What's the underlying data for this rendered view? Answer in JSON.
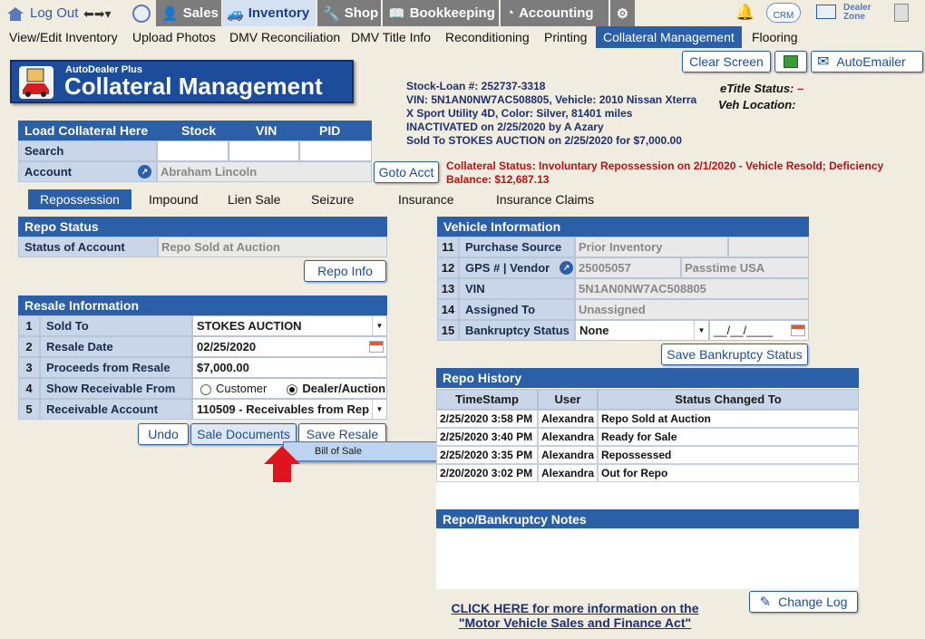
{
  "topnav": {
    "logout": "Log Out",
    "sales": "Sales",
    "inventory": "Inventory",
    "shop": "Shop",
    "bookkeeping": "Bookkeeping",
    "accounting": "Accounting",
    "crm": "CRM",
    "dealer_zone_1": "Dealer",
    "dealer_zone_2": "Zone"
  },
  "submenu": [
    "View/Edit Inventory",
    "Upload Photos",
    "DMV Reconciliation",
    "DMV Title Info",
    "Reconditioning",
    "Printing",
    "Collateral Management",
    "Flooring"
  ],
  "banner": {
    "small": "AutoDealer Plus",
    "title": "Collateral Management"
  },
  "toolbar": {
    "clear": "Clear Screen",
    "autoemail": "AutoEmailer"
  },
  "vehicle_summary": {
    "line1": "Stock-Loan #:  252737-3318",
    "line2": "VIN:  5N1AN0NW7AC508805, Vehicle:  2010 Nissan Xterra",
    "line3": "X Sport Utility 4D, Color: Silver, 81401 miles",
    "line4": "INACTIVATED on 2/25/2020 by A Azary",
    "line5": "Sold To STOKES AUCTION on 2/25/2020 for $7,000.00"
  },
  "etitle": {
    "label": "eTitle Status:",
    "value": "–",
    "veh_location": "Veh Location:"
  },
  "load": {
    "header": "Load Collateral Here",
    "stock": "Stock",
    "vin": "VIN",
    "pid": "PID",
    "search": "Search",
    "account": "Account",
    "account_value": "Abraham Lincoln",
    "goto": "Goto Acct"
  },
  "collateral_status": {
    "line1": "Collateral Status: Involuntary Repossession on 2/1/2020 - Vehicle Resold; Deficiency",
    "line2": "Balance: $12,687.13"
  },
  "tabs": [
    "Repossession",
    "Impound",
    "Lien Sale",
    "Seizure",
    "Insurance",
    "Insurance Claims"
  ],
  "repo_status": {
    "header": "Repo Status",
    "label": "Status of Account",
    "value": "Repo Sold at Auction",
    "button": "Repo Info"
  },
  "resale": {
    "header": "Resale Information",
    "rows": [
      {
        "n": "1",
        "label": "Sold To",
        "value": "STOKES AUCTION"
      },
      {
        "n": "2",
        "label": "Resale Date",
        "value": "02/25/2020"
      },
      {
        "n": "3",
        "label": "Proceeds from Resale",
        "value": "$7,000.00"
      },
      {
        "n": "4",
        "label": "Show Receivable From",
        "opt1": "Customer",
        "opt2": "Dealer/Auction"
      },
      {
        "n": "5",
        "label": "Receivable Account",
        "value": "110509 - Receivables from Rep"
      }
    ],
    "undo": "Undo",
    "sale_docs": "Sale Documents",
    "save": "Save Resale",
    "dropdown_item": "Bill of Sale"
  },
  "vehicle_info": {
    "header": "Vehicle Information",
    "rows": [
      {
        "n": "11",
        "label": "Purchase Source",
        "value": "Prior Inventory"
      },
      {
        "n": "12",
        "label": "GPS # | Vendor",
        "value": "25005057",
        "value2": "Passtime  USA"
      },
      {
        "n": "13",
        "label": "VIN",
        "value": "5N1AN0NW7AC508805"
      },
      {
        "n": "14",
        "label": "Assigned To",
        "value": "Unassigned"
      },
      {
        "n": "15",
        "label": "Bankruptcy Status",
        "value": "None",
        "date": "__/__/____"
      }
    ],
    "save_bk": "Save Bankruptcy Status"
  },
  "repo_history": {
    "header": "Repo History",
    "cols": [
      "TimeStamp",
      "User",
      "Status Changed To"
    ],
    "rows": [
      [
        "2/25/2020 3:58 PM",
        "Alexandra",
        "Repo Sold at Auction"
      ],
      [
        "2/25/2020 3:40 PM",
        "Alexandra",
        "Ready for Sale"
      ],
      [
        "2/25/2020 3:35 PM",
        "Alexandra",
        "Repossessed"
      ],
      [
        "2/20/2020 3:02 PM",
        "Alexandra",
        "Out for Repo"
      ]
    ]
  },
  "notes": {
    "header": "Repo/Bankruptcy Notes"
  },
  "footer": {
    "link1": "CLICK HERE for more information on the",
    "link2": "\"Motor Vehicle Sales and Finance Act\"",
    "change_log": "Change Log"
  }
}
